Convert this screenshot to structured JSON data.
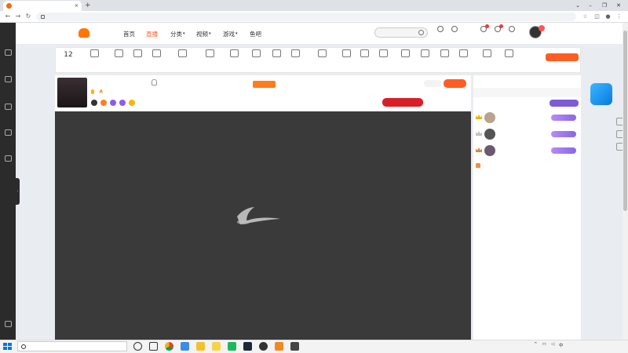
{
  "browser": {
    "tab_title": "",
    "url": ""
  },
  "sidebar": {
    "items": [
      {
        "label": ""
      },
      {
        "label": ""
      },
      {
        "label": ""
      },
      {
        "label": ""
      },
      {
        "label": ""
      },
      {
        "label": ""
      }
    ]
  },
  "header": {
    "logo_text": "",
    "nav": [
      {
        "label": "首页"
      },
      {
        "label": "直播"
      },
      {
        "label": "分类"
      },
      {
        "label": "视频"
      },
      {
        "label": "游戏"
      },
      {
        "label": "鱼吧"
      }
    ],
    "search_placeholder": "",
    "icons": [
      {
        "label": "",
        "badge": ""
      },
      {
        "label": "",
        "badge": ""
      },
      {
        "label": "",
        "badge": ""
      },
      {
        "label": "",
        "badge": ""
      },
      {
        "label": "",
        "badge": ""
      }
    ],
    "avatar_badge": ""
  },
  "toolstrip": {
    "level_number": "12",
    "level_label": "",
    "tools": [
      {
        "label": "",
        "badge": ""
      },
      {
        "label": "",
        "badge": ""
      },
      {
        "label": "",
        "badge": ""
      },
      {
        "label": "",
        "badge": ""
      },
      {
        "label": "",
        "badge": ""
      },
      {
        "label": "",
        "badge": ""
      },
      {
        "label": "",
        "badge": ""
      },
      {
        "label": "",
        "badge": ""
      },
      {
        "label": "",
        "badge": ""
      },
      {
        "label": "",
        "badge": ""
      },
      {
        "label": "",
        "badge": ""
      },
      {
        "label": "",
        "badge": ""
      },
      {
        "label": "",
        "badge": ""
      },
      {
        "label": "",
        "badge": ""
      },
      {
        "label": "",
        "badge": ""
      },
      {
        "label": "",
        "badge": ""
      },
      {
        "label": "",
        "badge": ""
      },
      {
        "label": "",
        "badge": ""
      },
      {
        "label": "",
        "badge": ""
      },
      {
        "label": "",
        "badge": ""
      }
    ],
    "pc_button": "",
    "pc_sub": ""
  },
  "room": {
    "title": "",
    "avatar_label": "",
    "host_name": "",
    "host_level": "",
    "heat": "",
    "tags": [
      {
        "label": "",
        "color": "#333333"
      },
      {
        "label": "",
        "color": "#ff7d1c"
      },
      {
        "label": "",
        "color": "#8a5cf0"
      },
      {
        "label": "",
        "color": "#8a5cf0"
      },
      {
        "label": "",
        "color": "#f7b500"
      }
    ],
    "notice_title": "",
    "notice_text": "",
    "notice_button": "",
    "hot_number": "",
    "follow_button": "",
    "task_button": "",
    "share_label": "",
    "report_label": ""
  },
  "player": {
    "message": ""
  },
  "right_panel": {
    "tab_contrib": "",
    "tab_noble": "",
    "rank_tabs": [
      "",
      "",
      "",
      ""
    ],
    "rank_hint": "",
    "vip_button": "",
    "ranks": [
      {
        "name": ""
      },
      {
        "name": ""
      },
      {
        "name": ""
      }
    ],
    "sys_label": "",
    "sys_text": ""
  },
  "side": {
    "task_badge": ""
  },
  "overlay": {
    "qq_group": "",
    "douyin": "",
    "bilibili": ""
  },
  "taskbar": {
    "search_placeholder": "",
    "time": "",
    "date": ""
  },
  "colors": {
    "brand": "#ff5d23",
    "player_bg": "#3a3a3a",
    "task_red": "#d81f26"
  }
}
